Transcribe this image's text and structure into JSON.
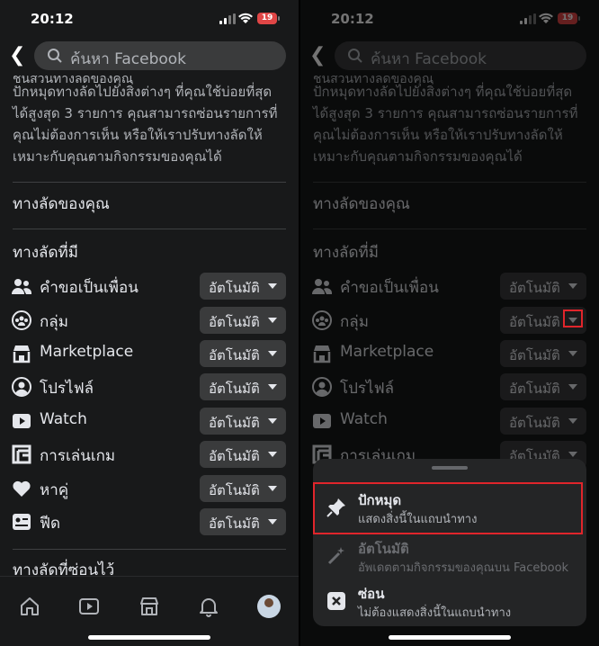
{
  "status": {
    "time": "20:12",
    "battery": "19"
  },
  "search": {
    "placeholder": "ค้นหา Facebook"
  },
  "description": {
    "cut_line": "ชิ้นส่วนทางลัดของคุณ",
    "text": "ปักหมุดทางลัดไปยังสิ่งต่างๆ ที่คุณใช้บ่อยที่สุดได้สูงสุด 3 รายการ คุณสามารถซ่อนรายการที่คุณไม่ต้องการเห็น หรือให้เราปรับทางลัดให้เหมาะกับคุณตามกิจกรรมของคุณได้"
  },
  "sections": {
    "your_shortcuts": "ทางลัดของคุณ",
    "available": "ทางลัดที่มี",
    "hidden": "ทางลัดที่ซ่อนไว้"
  },
  "shortcuts": [
    {
      "label": "คำขอเป็นเพื่อน",
      "value": "อัตโนมัติ",
      "icon": "friends-icon"
    },
    {
      "label": "กลุ่ม",
      "value": "อัตโนมัติ",
      "icon": "groups-icon"
    },
    {
      "label": "Marketplace",
      "value": "อัตโนมัติ",
      "icon": "marketplace-icon"
    },
    {
      "label": "โปรไฟล์",
      "value": "อัตโนมัติ",
      "icon": "profile-icon"
    },
    {
      "label": "Watch",
      "value": "อัตโนมัติ",
      "icon": "watch-icon"
    },
    {
      "label": "การเล่นเกม",
      "value": "อัตโนมัติ",
      "icon": "gaming-icon"
    },
    {
      "label": "หาคู่",
      "value": "อัตโนมัติ",
      "icon": "dating-icon"
    },
    {
      "label": "ฟีด",
      "value": "อัตโนมัติ",
      "icon": "feeds-icon"
    }
  ],
  "sheet": {
    "options": [
      {
        "title": "ปักหมุด",
        "subtitle": "แสดงสิ่งนี้ในแถบนำทาง",
        "icon": "pin-icon"
      },
      {
        "title": "อัตโนมัติ",
        "subtitle": "อัพเดตตามกิจกรรมของคุณบน Facebook",
        "icon": "magic-wand-icon",
        "disabled": true
      },
      {
        "title": "ซ่อน",
        "subtitle": "ไม่ต้องแสดงสิ่งนี้ในแถบนำทาง",
        "icon": "close-box-icon"
      }
    ]
  },
  "tabs": [
    "home-icon",
    "video-icon",
    "marketplace-icon",
    "bell-icon",
    "avatar"
  ],
  "colors": {
    "highlight": "#e0252b",
    "background": "#18191a",
    "pill": "#3a3b3c"
  }
}
